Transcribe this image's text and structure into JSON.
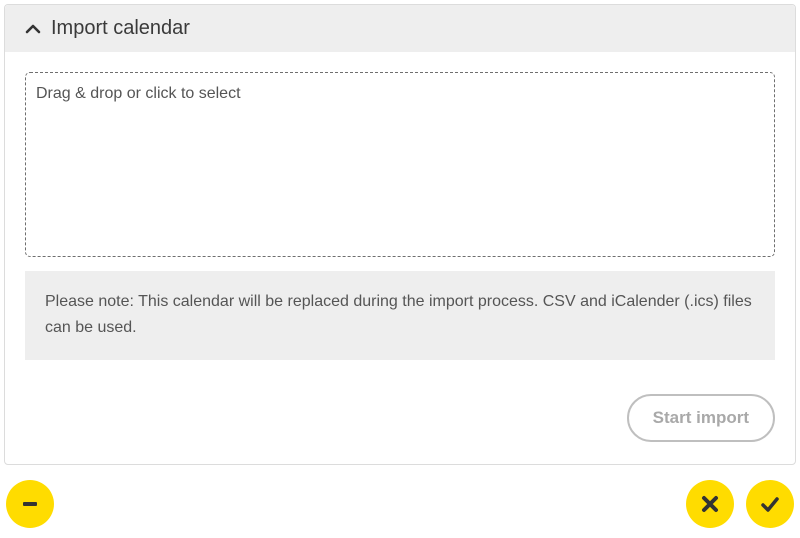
{
  "panel": {
    "title": "Import calendar",
    "dropzone_text": "Drag & drop or click to select",
    "note_text": "Please note: This calendar will be replaced during the import process. CSV and iCalender (.ics) files can be used.",
    "start_label": "Start import"
  },
  "footer": {
    "remove_icon": "minus-icon",
    "cancel_icon": "cancel-icon",
    "confirm_icon": "check-icon"
  }
}
